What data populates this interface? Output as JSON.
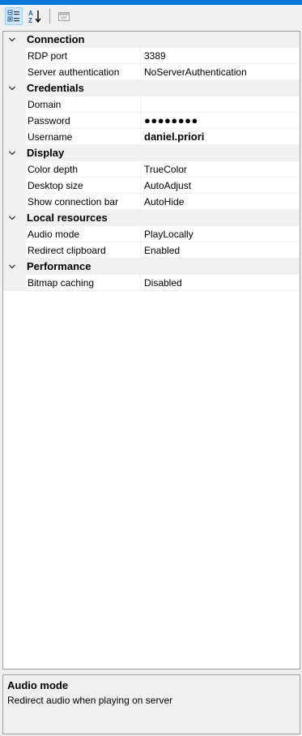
{
  "toolbar": {
    "categorized_icon": "categorized-icon",
    "alphabetical_icon": "sort-alphabetical-icon",
    "property_pages_icon": "property-pages-icon"
  },
  "categories": [
    {
      "label": "Connection",
      "properties": [
        {
          "name": "RDP port",
          "value": "3389"
        },
        {
          "name": "Server authentication",
          "value": "NoServerAuthentication"
        }
      ]
    },
    {
      "label": "Credentials",
      "properties": [
        {
          "name": "Domain",
          "value": ""
        },
        {
          "name": "Password",
          "value": "●●●●●●●●"
        },
        {
          "name": "Username",
          "value": "daniel.priori"
        }
      ]
    },
    {
      "label": "Display",
      "properties": [
        {
          "name": "Color depth",
          "value": "TrueColor"
        },
        {
          "name": "Desktop size",
          "value": "AutoAdjust"
        },
        {
          "name": "Show connection bar",
          "value": "AutoHide"
        }
      ]
    },
    {
      "label": "Local resources",
      "properties": [
        {
          "name": "Audio mode",
          "value": "PlayLocally"
        },
        {
          "name": "Redirect clipboard",
          "value": "Enabled"
        }
      ]
    },
    {
      "label": "Performance",
      "properties": [
        {
          "name": "Bitmap caching",
          "value": "Disabled"
        }
      ]
    }
  ],
  "help": {
    "title": "Audio mode",
    "description": "Redirect audio when playing on server"
  }
}
